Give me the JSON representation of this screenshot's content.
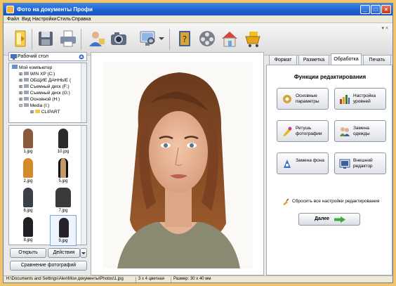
{
  "window": {
    "title": "Фото на документы Профи",
    "minimize": "_",
    "maximize": "□",
    "close": "×"
  },
  "menu": [
    "Файл",
    "Вид",
    "Настройки",
    "Стиль",
    "Справка"
  ],
  "toolbar": {
    "icons": [
      "open-file-icon",
      "save-icon",
      "print-icon",
      "user-photo-icon",
      "camera-icon",
      "monitor-icon",
      "help-book-icon",
      "film-icon",
      "home-icon",
      "cart-icon"
    ],
    "corner": "▾ ×"
  },
  "folder": {
    "header": "Рабочий стол",
    "tree": [
      {
        "label": "Мой компьютер",
        "depth": 0
      },
      {
        "label": "WIN XP (C:)",
        "depth": 1
      },
      {
        "label": "ОБЩИЕ ДАННЫЕ (",
        "depth": 1
      },
      {
        "label": "Съемный диск (F:)",
        "depth": 1
      },
      {
        "label": "Съемный диск (G:)",
        "depth": 1
      },
      {
        "label": "Основной (H:)",
        "depth": 1
      },
      {
        "label": "Media (I:)",
        "depth": 1
      },
      {
        "label": "CLIPART",
        "depth": 2
      }
    ]
  },
  "thumbnails": [
    {
      "label": "1.jpg",
      "color": "#8a5a3a"
    },
    {
      "label": "10.jpg",
      "color": "#2a2a2a"
    },
    {
      "label": "2.jpg",
      "color": "#d48a2c"
    },
    {
      "label": "5.jpg",
      "color": "#c49a6a"
    },
    {
      "label": "6.jpg",
      "color": "#3a3f4a"
    },
    {
      "label": "7.jpg",
      "color": "#3a3a3a"
    },
    {
      "label": "8.jpg",
      "color": "#1f1f24"
    },
    {
      "label": "9.jpg",
      "color": "#24242a"
    }
  ],
  "left_buttons": {
    "open": "Открыть",
    "actions": "Действия",
    "compare": "Сравнение фотографий"
  },
  "tabs": [
    "Формат",
    "Разметка",
    "Обработка",
    "Печать"
  ],
  "active_tab": "Обработка",
  "panel": {
    "title": "Функции редактирования",
    "buttons": [
      {
        "label": "Основные параметры",
        "icon": "basic-settings-icon",
        "color": "#d7a23b"
      },
      {
        "label": "Настройка уровней",
        "icon": "levels-icon",
        "color": "#c8382e"
      },
      {
        "label": "Ретушь фотографии",
        "icon": "retouch-icon",
        "color": "#e6b82b"
      },
      {
        "label": "Замена одежды",
        "icon": "clothes-icon",
        "color": "#5a8f3a"
      },
      {
        "label": "Замена фона",
        "icon": "background-icon",
        "color": "#3a6fc6"
      },
      {
        "label": "Внешний редактор",
        "icon": "external-editor-icon",
        "color": "#3a5f9a"
      }
    ],
    "reset": "Сбросить все настройки редактирования",
    "next": "Далее"
  },
  "status": {
    "path": "H:\\Documents and Settings\\Alex\\Мои документы\\Photos\\1.jpg",
    "format": "3 x 4 цветная",
    "size": "Размер: 30 x 40 мм"
  }
}
